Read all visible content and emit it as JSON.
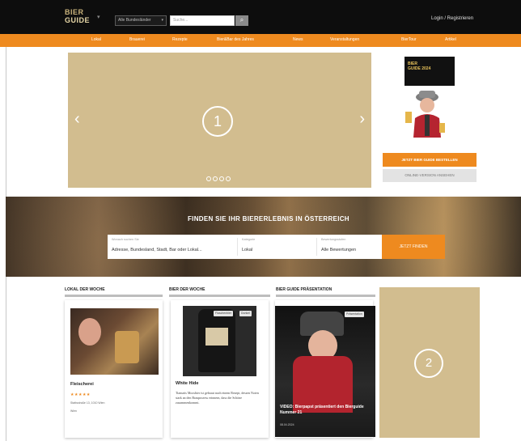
{
  "header": {
    "logo_line1": "BIER",
    "logo_line2": "GUIDE",
    "region_select": "Alle Bundesländer",
    "search_placeholder": "Suche...",
    "login": "Login / Registrieren"
  },
  "nav": {
    "items": [
      "Lokal",
      "Brauerei",
      "Rezepte",
      "Bier&Bar des Jahres",
      "News",
      "Veranstaltungen",
      "BierTour",
      "Artikel"
    ]
  },
  "hero": {
    "badge": "1",
    "slide_count": 4,
    "prev": "‹",
    "next": "›"
  },
  "sidebar": {
    "book_title_1": "BIER",
    "book_title_2": "GUIDE 2024",
    "order_button": "JETZT BIER GUIDE BESTELLEN",
    "online_button": "ONLINE-VERSION ANSEHEN"
  },
  "search_banner": {
    "title": "FINDEN SIE IHR BIERERLEBNIS IN ÖSTERREICH",
    "field1_label": "Wonach suchen Sie",
    "field1_value": "Adresse, Bundesland, Stadt, Bar oder Lokal...",
    "field2_label": "Kategorie",
    "field2_value": "Lokal",
    "field3_label": "Bewertungsstufen",
    "field3_value": "Alle Bewertungen",
    "button": "JETZT FINDEN"
  },
  "sections": {
    "lokal": {
      "heading": "LOKAL DER WOCHE",
      "title": "Fleischerei",
      "stars": "★★★★★",
      "meta1": "Stattsstraße 13, 1010 Wien",
      "meta2": "Wien"
    },
    "bier": {
      "heading": "BIER DER WOCHE",
      "tag1": "Flaschenbier",
      "tag2": "Dunkel",
      "title": "White Hide",
      "text": "Tiamatis Moosbier ist gebraut nach einem Rezept, dessen Noten stark an den Brauprozess erinnern, dass die Schöne zusammenkommt."
    },
    "praesentation": {
      "heading": "BIER GUIDE PRÄSENTATION",
      "tag": "Präsentation",
      "headline": "VIDEO: Bierpapst präsentiert den Bierguide Nummer 21",
      "date": "08.04.2024"
    }
  },
  "ad": {
    "badge": "2"
  },
  "colors": {
    "orange": "#ee8a1f",
    "placeholder_tan": "#d2bd8f",
    "top_bar": "#0d0d0d"
  }
}
